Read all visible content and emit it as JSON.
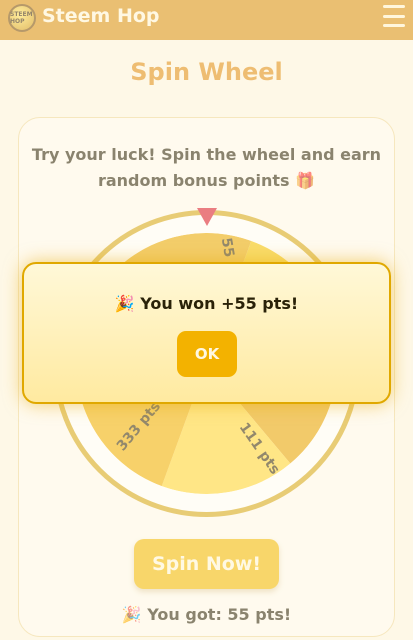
{
  "header": {
    "brand": "Steem Hop",
    "logo_text": "STEEM HOP",
    "menu_icon": "hamburger-menu-icon"
  },
  "page": {
    "title": "Spin Wheel",
    "intro": "Try your luck! Spin the wheel and earn random bonus points 🎁",
    "spin_button": "Spin Now!",
    "result": "🎉 You got: 55 pts!"
  },
  "wheel": {
    "labels": [
      "55 pts",
      "333 pts",
      "111 pts"
    ],
    "colors": [
      "#f5c400",
      "#e7a300",
      "#ffd633",
      "#f0b000",
      "#fbd000",
      "#e9a800"
    ]
  },
  "modal": {
    "message": "🎉 You won +55 pts!",
    "ok_label": "OK"
  },
  "colors": {
    "accent": "#d98f10",
    "title": "#e08a10",
    "button": "#f3b800",
    "pointer": "#d9162b"
  }
}
